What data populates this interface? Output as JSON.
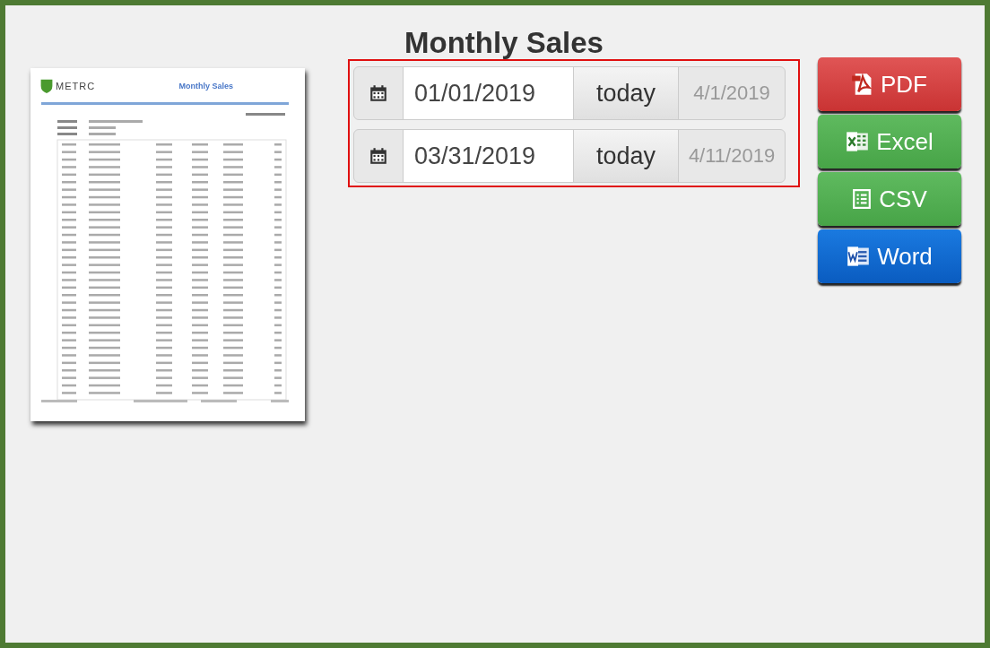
{
  "title": "Monthly Sales",
  "preview": {
    "logo": "METRC",
    "title": "Monthly Sales"
  },
  "date_ranges": [
    {
      "value": "01/01/2019",
      "button": "today",
      "hint": "4/1/2019"
    },
    {
      "value": "03/31/2019",
      "button": "today",
      "hint": "4/11/2019"
    }
  ],
  "export_buttons": [
    {
      "kind": "pdf",
      "label": "PDF"
    },
    {
      "kind": "excel",
      "label": "Excel"
    },
    {
      "kind": "csv",
      "label": "CSV"
    },
    {
      "kind": "word",
      "label": "Word"
    }
  ]
}
